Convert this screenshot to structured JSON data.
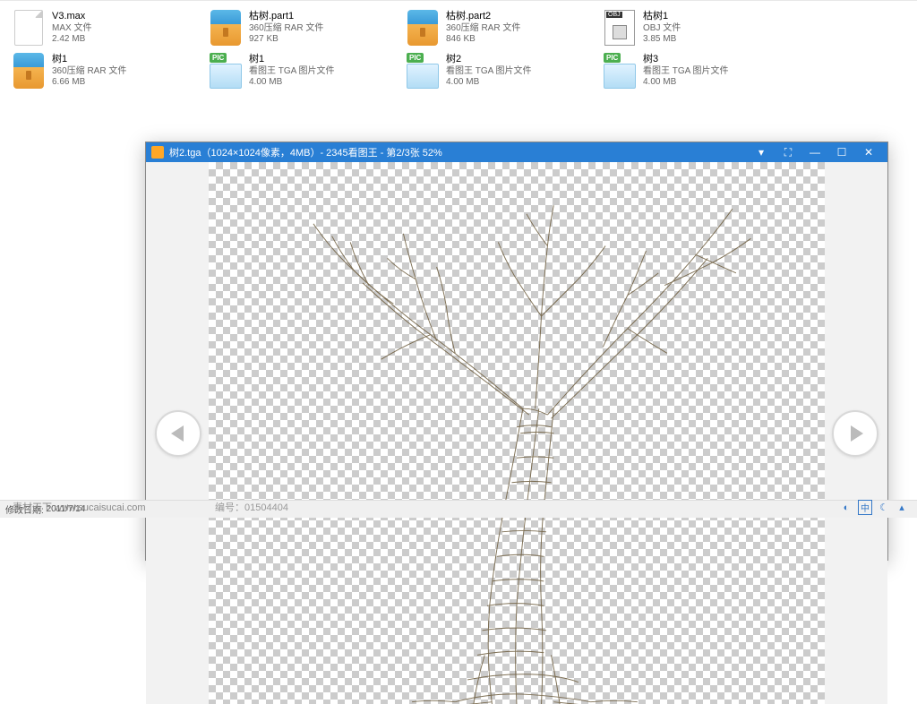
{
  "files": [
    {
      "name": "V3.max",
      "type": "MAX 文件",
      "size": "2.42 MB",
      "icon": "max"
    },
    {
      "name": "枯树.part1",
      "type": "360压缩 RAR 文件",
      "size": "927 KB",
      "icon": "rar"
    },
    {
      "name": "枯树.part2",
      "type": "360压缩 RAR 文件",
      "size": "846 KB",
      "icon": "rar"
    },
    {
      "name": "枯树1",
      "type": "OBJ 文件",
      "size": "3.85 MB",
      "icon": "obj"
    },
    {
      "name": "树1",
      "type": "360压缩 RAR 文件",
      "size": "6.66 MB",
      "icon": "rar"
    },
    {
      "name": "树1",
      "type": "看图王 TGA 图片文件",
      "size": "4.00 MB",
      "icon": "pic"
    },
    {
      "name": "树2",
      "type": "看图王 TGA 图片文件",
      "size": "4.00 MB",
      "icon": "pic"
    },
    {
      "name": "树3",
      "type": "看图王 TGA 图片文件",
      "size": "4.00 MB",
      "icon": "pic"
    }
  ],
  "viewer": {
    "title": "树2.tga（1024×1024像素，4MB）- 2345看图王 - 第2/3张 52%"
  },
  "statusbar": {
    "date_label": "修改日期:",
    "date_value": "2011/7/14"
  },
  "watermark": {
    "site": "素材天下 www.sucaisucai.com",
    "code": "编号：01504404"
  },
  "status_lang": "中"
}
